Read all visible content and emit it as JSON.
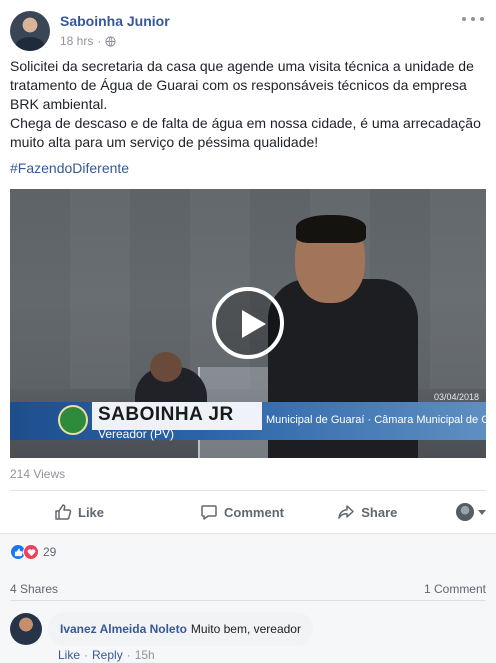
{
  "post": {
    "author": "Saboinha Junior",
    "time": "18 hrs",
    "separator": "·",
    "text_lines": [
      "Solicitei da secretaria da casa que agende uma visita técnica a unidade de tratamento de Água de Guarai com os responsáveis técnicos da empresa BRK ambiental.",
      "Chega de descaso e de falta de água em nossa cidade, é uma arrecadação muito alta para um serviço de péssima qualidade!"
    ],
    "hashtag": "#FazendoDiferente"
  },
  "video": {
    "overlay_name": "SABOINHA JR",
    "overlay_role": "Vereador (PV)",
    "overlay_ticker": "Municipal de Guaraí · Câmara Municipal de Guaraí · Câm",
    "overlay_date": "03/04/2018",
    "views": "214 Views"
  },
  "actions": {
    "like": "Like",
    "comment": "Comment",
    "share": "Share"
  },
  "feedback": {
    "reaction_count": "29",
    "shares": "4 Shares",
    "comments": "1 Comment"
  },
  "comment": {
    "author": "Ivanez Almeida Noleto",
    "text": "Muito bem, vereador",
    "like": "Like",
    "reply": "Reply",
    "dot": "·",
    "time": "15h"
  },
  "colors": {
    "link": "#365899",
    "like_reaction": "#1877f2",
    "love_reaction": "#f33e58"
  }
}
